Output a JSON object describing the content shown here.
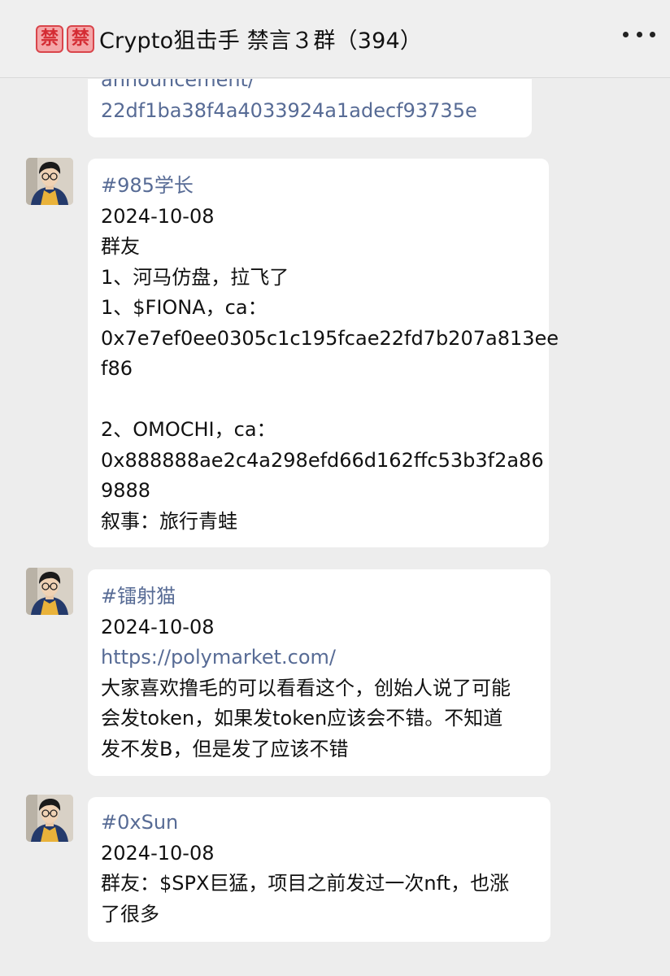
{
  "header": {
    "badges": [
      "禁",
      "禁"
    ],
    "title": "Crypto狙击手 禁言３群（394）",
    "more_icon": "more-dots-icon"
  },
  "messages": [
    {
      "lines": [
        "announcement/",
        "22df1ba38f4a4033924a1adecf93735e"
      ]
    },
    {
      "tag": "#985学长",
      "date": "2024-10-08",
      "lines": [
        "群友",
        "1、河马仿盘，拉飞了",
        "1、$FIONA，ca：",
        "0x7e7ef0ee0305c1c195fcae22fd7b207a813ee",
        "f86",
        "",
        "2、OMOCHI，ca：",
        "0x888888ae2c4a298efd66d162ffc53b3f2a86",
        "9888",
        "叙事：旅行青蛙"
      ]
    },
    {
      "tag": "#镭射猫",
      "date": "2024-10-08",
      "link": "https://polymarket.com/",
      "lines": [
        "大家喜欢撸毛的可以看看这个，创始人说了可能",
        "会发token，如果发token应该会不错。不知道",
        "发不发B，但是发了应该不错"
      ]
    },
    {
      "tag": "#0xSun",
      "date": "2024-10-08",
      "lines": [
        "群友：$SPX巨猛，项目之前发过一次nft，也涨",
        "了很多"
      ]
    }
  ]
}
